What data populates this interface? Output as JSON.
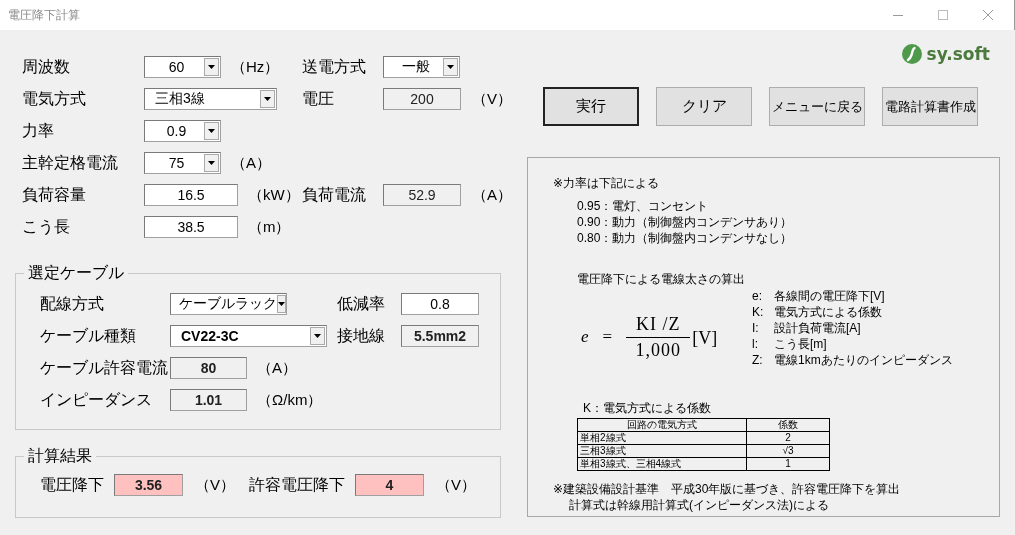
{
  "window": {
    "title": "電圧降下計算"
  },
  "logo": {
    "text": "sy.soft"
  },
  "main_form": {
    "rows": [
      {
        "left": {
          "label": "周波数",
          "field": {
            "kind": "combo",
            "value": "60"
          },
          "unit": "（Hz）"
        },
        "right": {
          "label": "送電方式",
          "field": {
            "kind": "combo",
            "value": "一般"
          }
        }
      },
      {
        "left": {
          "label": "電気方式",
          "field": {
            "kind": "combo",
            "value": "三相3線"
          }
        },
        "right": {
          "label": "電圧",
          "field": {
            "kind": "display",
            "value": "200"
          },
          "unit": "（V）"
        }
      },
      {
        "left": {
          "label": "力率",
          "field": {
            "kind": "combo",
            "value": "0.9"
          }
        }
      },
      {
        "left": {
          "label": "主幹定格電流",
          "field": {
            "kind": "combo",
            "value": "75"
          },
          "unit": "（A）"
        }
      },
      {
        "left": {
          "label": "負荷容量",
          "field": {
            "kind": "input",
            "value": "16.5"
          },
          "unit": "（kW）"
        },
        "right": {
          "label": "負荷電流",
          "field": {
            "kind": "display",
            "value": "52.9"
          },
          "unit": "（A）"
        }
      },
      {
        "left": {
          "label": "こう長",
          "field": {
            "kind": "input",
            "value": "38.5"
          },
          "unit": "（m）"
        }
      }
    ]
  },
  "buttons": [
    {
      "label": "実行",
      "default": true
    },
    {
      "label": "クリア",
      "default": false
    },
    {
      "label": "メニューに戻る",
      "default": false
    },
    {
      "label": "電路計算書作成",
      "default": false
    }
  ],
  "cable_group": {
    "title": "選定ケーブル",
    "rows": [
      {
        "left": {
          "label": "配線方式",
          "field": {
            "kind": "combo",
            "value": "ケーブルラック"
          }
        },
        "right": {
          "label": "低減率",
          "field": {
            "kind": "input",
            "value": "0.8"
          }
        }
      },
      {
        "left": {
          "label": "ケーブル種類",
          "field": {
            "kind": "combo",
            "value": "CV22-3C"
          }
        },
        "right": {
          "label": "接地線",
          "field": {
            "kind": "display",
            "value": "5.5mm2"
          }
        }
      },
      {
        "left": {
          "label": "ケーブル許容電流",
          "field": {
            "kind": "display",
            "value": "80"
          },
          "unit": "（A）"
        }
      },
      {
        "left": {
          "label": "インピーダンス",
          "field": {
            "kind": "display",
            "value": "1.01"
          },
          "unit": "（Ω/km）"
        }
      }
    ]
  },
  "result_group": {
    "title": "計算結果",
    "items": [
      {
        "label": "電圧降下",
        "value": "3.56",
        "unit": "（V）"
      },
      {
        "label": "許容電圧降下",
        "value": "4",
        "unit": "（V）"
      }
    ]
  },
  "info_panel": {
    "power_factor_title": "※力率は下記による",
    "power_factor_items": [
      "0.95：電灯、コンセント",
      "0.90：動力（制御盤内コンデンサあり）",
      "0.80：動力（制御盤内コンデンサなし）"
    ],
    "formula_title": "電圧降下による電線太さの算出",
    "formula": {
      "lhs": "e",
      "equals": "=",
      "numerator": "KI /Z",
      "denominator": "1,000",
      "unit": "[V]"
    },
    "definitions": [
      {
        "symbol": "e:",
        "text": "各線間の電圧降下[V]"
      },
      {
        "symbol": "K:",
        "text": "電気方式による係数"
      },
      {
        "symbol": "I:",
        "text": "設計負荷電流[A]"
      },
      {
        "symbol": "l:",
        "text": "こう長[m]"
      },
      {
        "symbol": "Z:",
        "text": "電線1kmあたりのインピーダンス"
      }
    ],
    "k_table": {
      "title": "K：電気方式による係数",
      "columns": [
        "回路の電気方式",
        "係数"
      ],
      "rows": [
        [
          "単相2線式",
          "2"
        ],
        [
          "三相3線式",
          "√3"
        ],
        [
          "単相3線式、三相4線式",
          "1"
        ]
      ]
    },
    "notes": [
      "※建築設備設計基準　平成30年版に基づき、許容電圧降下を算出",
      "計算式は幹線用計算式(インピーダンス法)による"
    ]
  }
}
